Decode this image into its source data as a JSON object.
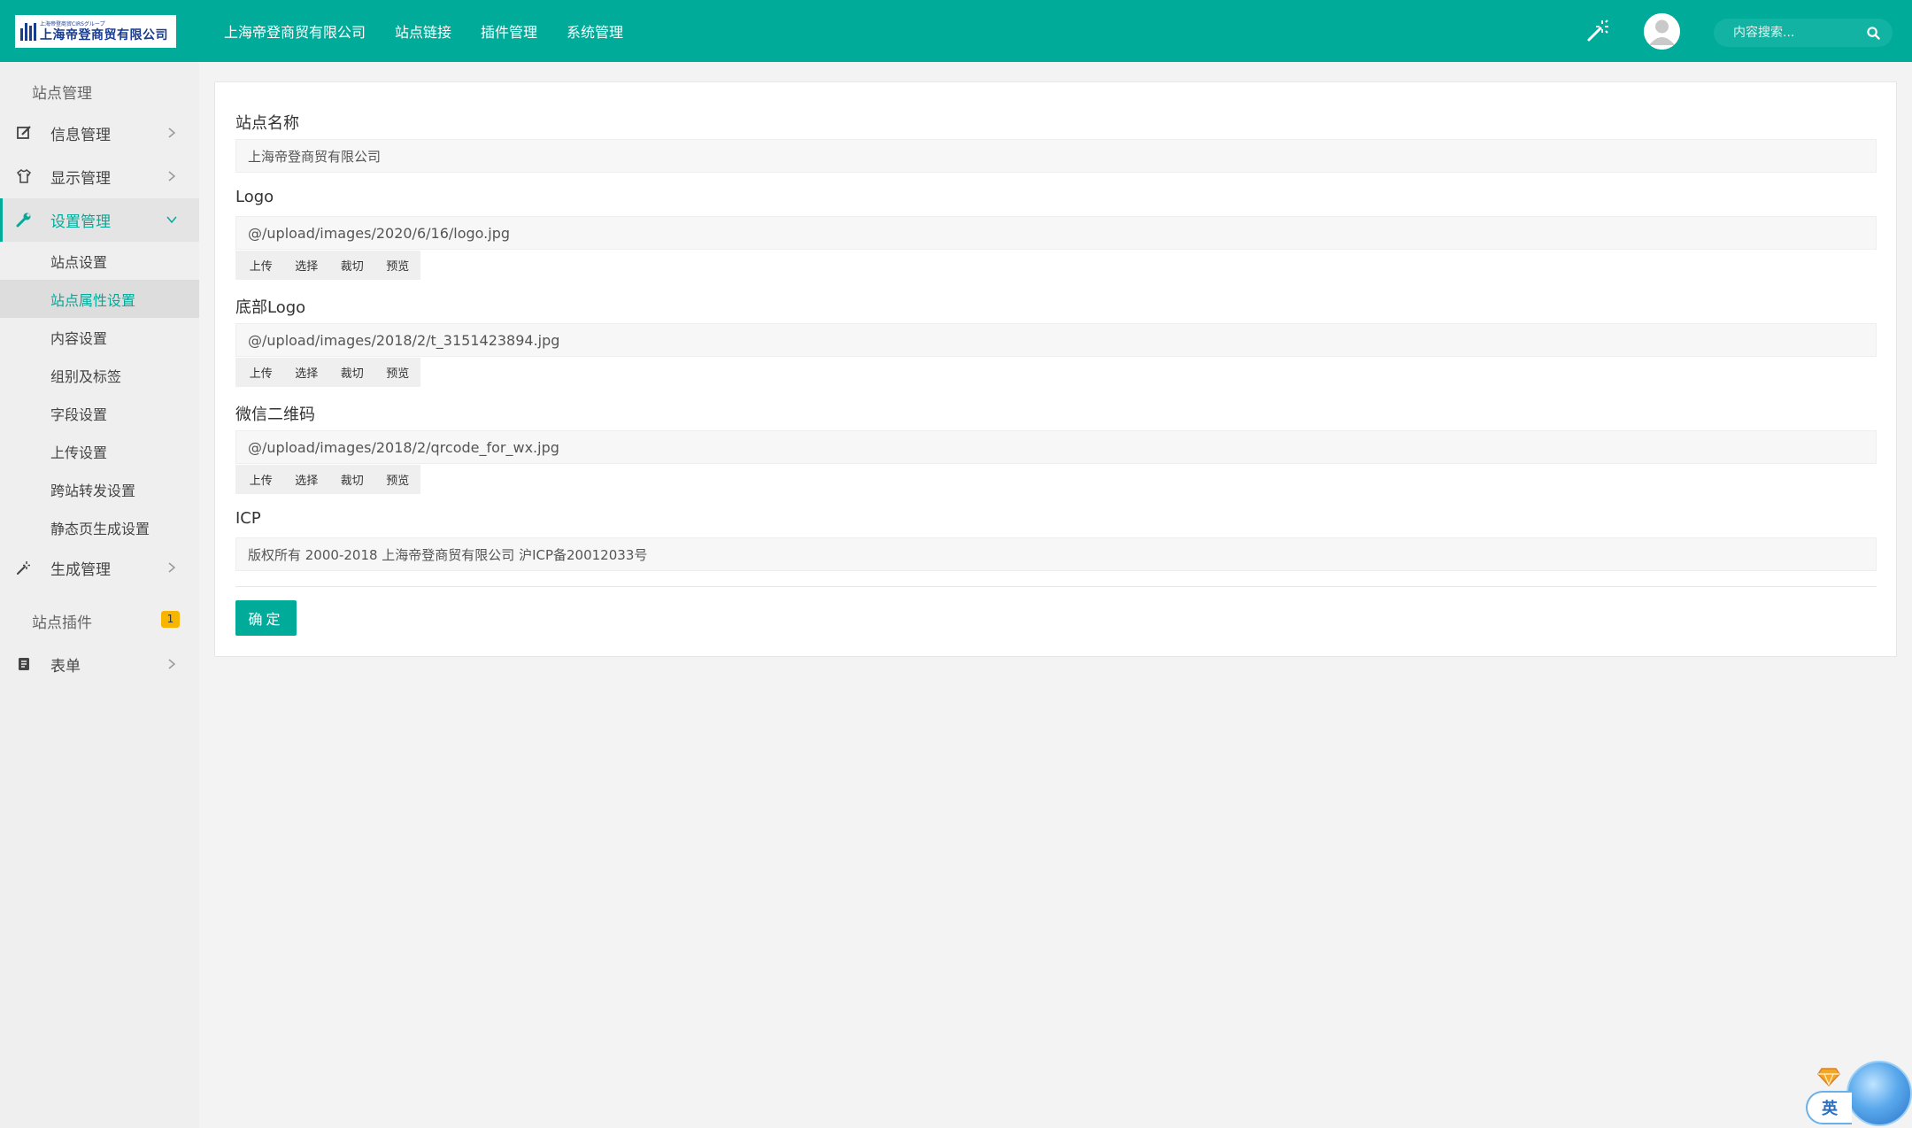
{
  "header": {
    "logo": {
      "small_text": "上海帝登商贸CIRSグループ",
      "big_text": "上海帝登商贸有限公司"
    },
    "nav": [
      {
        "label": "上海帝登商贸有限公司"
      },
      {
        "label": "站点链接"
      },
      {
        "label": "插件管理"
      },
      {
        "label": "系统管理"
      }
    ],
    "search": {
      "placeholder": "内容搜索..."
    }
  },
  "sidebar": {
    "group_title": "站点管理",
    "items": [
      {
        "label": "信息管理",
        "icon": "edit-icon"
      },
      {
        "label": "显示管理",
        "icon": "shirt-icon"
      },
      {
        "label": "设置管理",
        "icon": "wrench-icon"
      }
    ],
    "sub_items": [
      {
        "label": "站点设置"
      },
      {
        "label": "站点属性设置"
      },
      {
        "label": "内容设置"
      },
      {
        "label": "组别及标签"
      },
      {
        "label": "字段设置"
      },
      {
        "label": "上传设置"
      },
      {
        "label": "跨站转发设置"
      },
      {
        "label": "静态页生成设置"
      }
    ],
    "generate_item": {
      "label": "生成管理",
      "icon": "magic-wand-icon"
    },
    "plugin_group": {
      "title": "站点插件",
      "badge": "1"
    },
    "form_item": {
      "label": "表单",
      "icon": "form-icon"
    }
  },
  "form": {
    "site_name": {
      "label": "站点名称",
      "value": "上海帝登商贸有限公司"
    },
    "logo": {
      "label": "Logo",
      "value": "@/upload/images/2020/6/16/logo.jpg"
    },
    "footer_logo": {
      "label": "底部Logo",
      "value": "@/upload/images/2018/2/t_3151423894.jpg"
    },
    "wechat_qr": {
      "label": "微信二维码",
      "value": "@/upload/images/2018/2/qrcode_for_wx.jpg"
    },
    "icp": {
      "label": "ICP",
      "value": "版权所有 2000-2018 上海帝登商贸有限公司 沪ICP备20012033号"
    },
    "file_buttons": {
      "upload": "上传",
      "select": "选择",
      "crop": "裁切",
      "preview": "预览"
    },
    "submit_label": "确定"
  },
  "ime": {
    "lang": "英"
  },
  "colors": {
    "accent": "#00ab9a",
    "badge": "#f7b500"
  }
}
